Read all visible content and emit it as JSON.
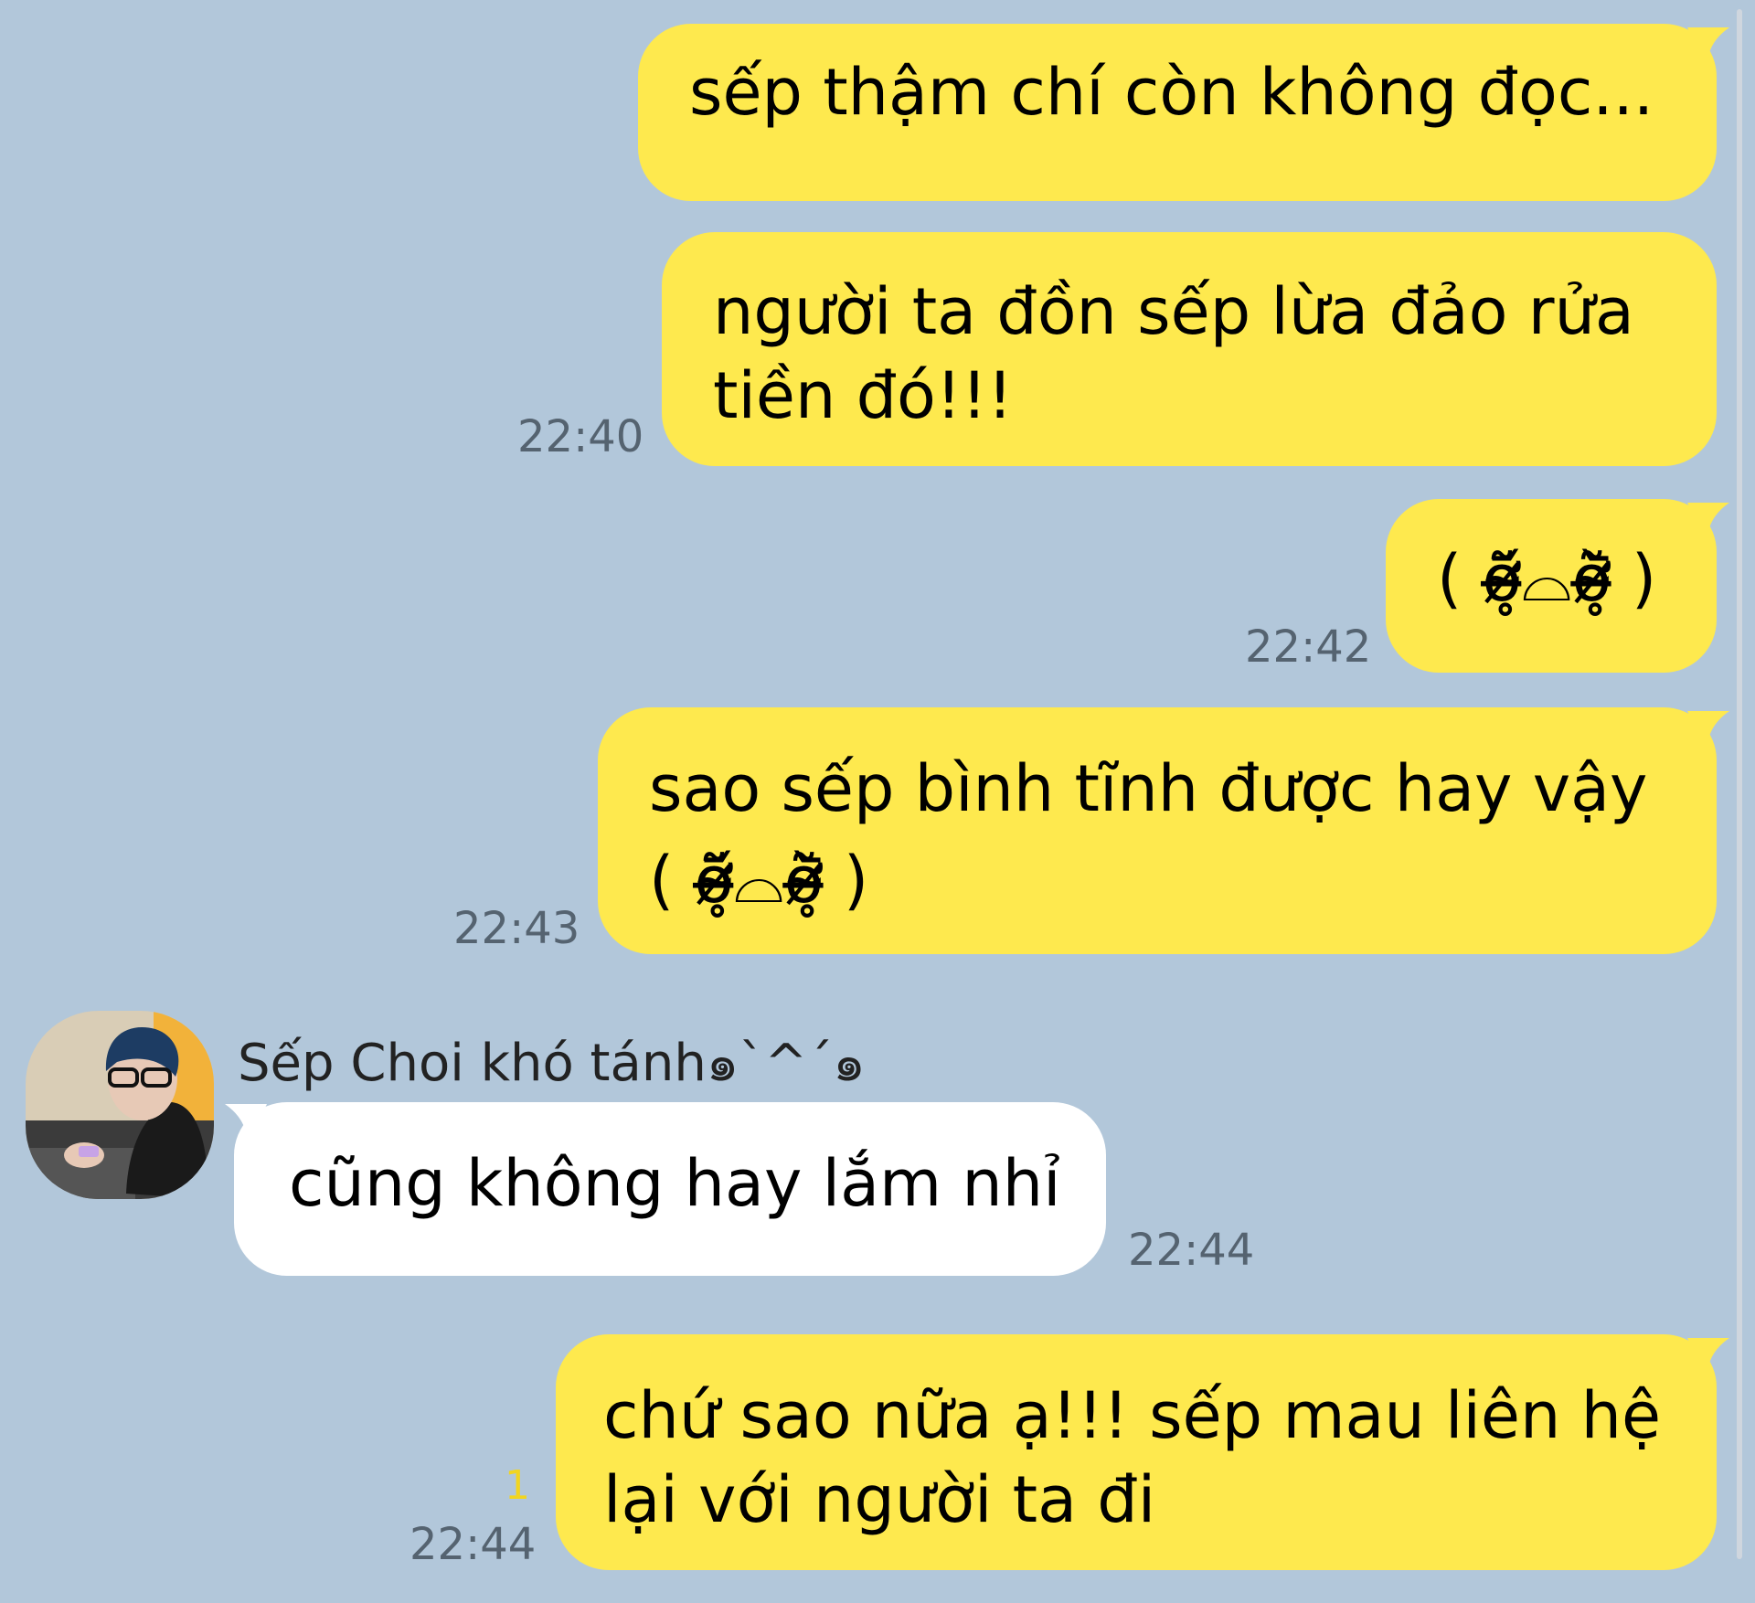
{
  "colors": {
    "background": "#b2c7da",
    "my_bubble": "#fee94e",
    "other_bubble": "#ffffff",
    "timestamp": "#556370",
    "unread": "#f2d520"
  },
  "messages": [
    {
      "sender": "me",
      "lines": [
        "sếp thậm chí còn không đọc..."
      ],
      "time": ""
    },
    {
      "sender": "me",
      "lines": [
        "người ta đồn sếp lừa đảo rửa",
        "tiền đó!!!"
      ],
      "time": "22:40"
    },
    {
      "sender": "me",
      "lines": [
        "( ỡ̴̶̷̥᷄⌓ỡ̴̶̷̥᷅ )"
      ],
      "time": "22:42"
    },
    {
      "sender": "me",
      "lines": [
        "sao sếp bình tĩnh được hay vậy",
        "( ỡ̴̶̷̥᷄⌓ỡ̴̶̷̥᷅ )"
      ],
      "time": "22:43"
    },
    {
      "sender": "other",
      "name": "Sếp Choi khó tánh๑`^´๑",
      "avatar_icon": "user-avatar-photo",
      "lines": [
        "cũng không hay lắm nhỉ"
      ],
      "time": "22:44"
    },
    {
      "sender": "me",
      "lines": [
        "chứ sao nữa ạ!!! sếp mau liên hệ",
        "lại với người ta đi"
      ],
      "time": "22:44",
      "unread": "1"
    }
  ]
}
